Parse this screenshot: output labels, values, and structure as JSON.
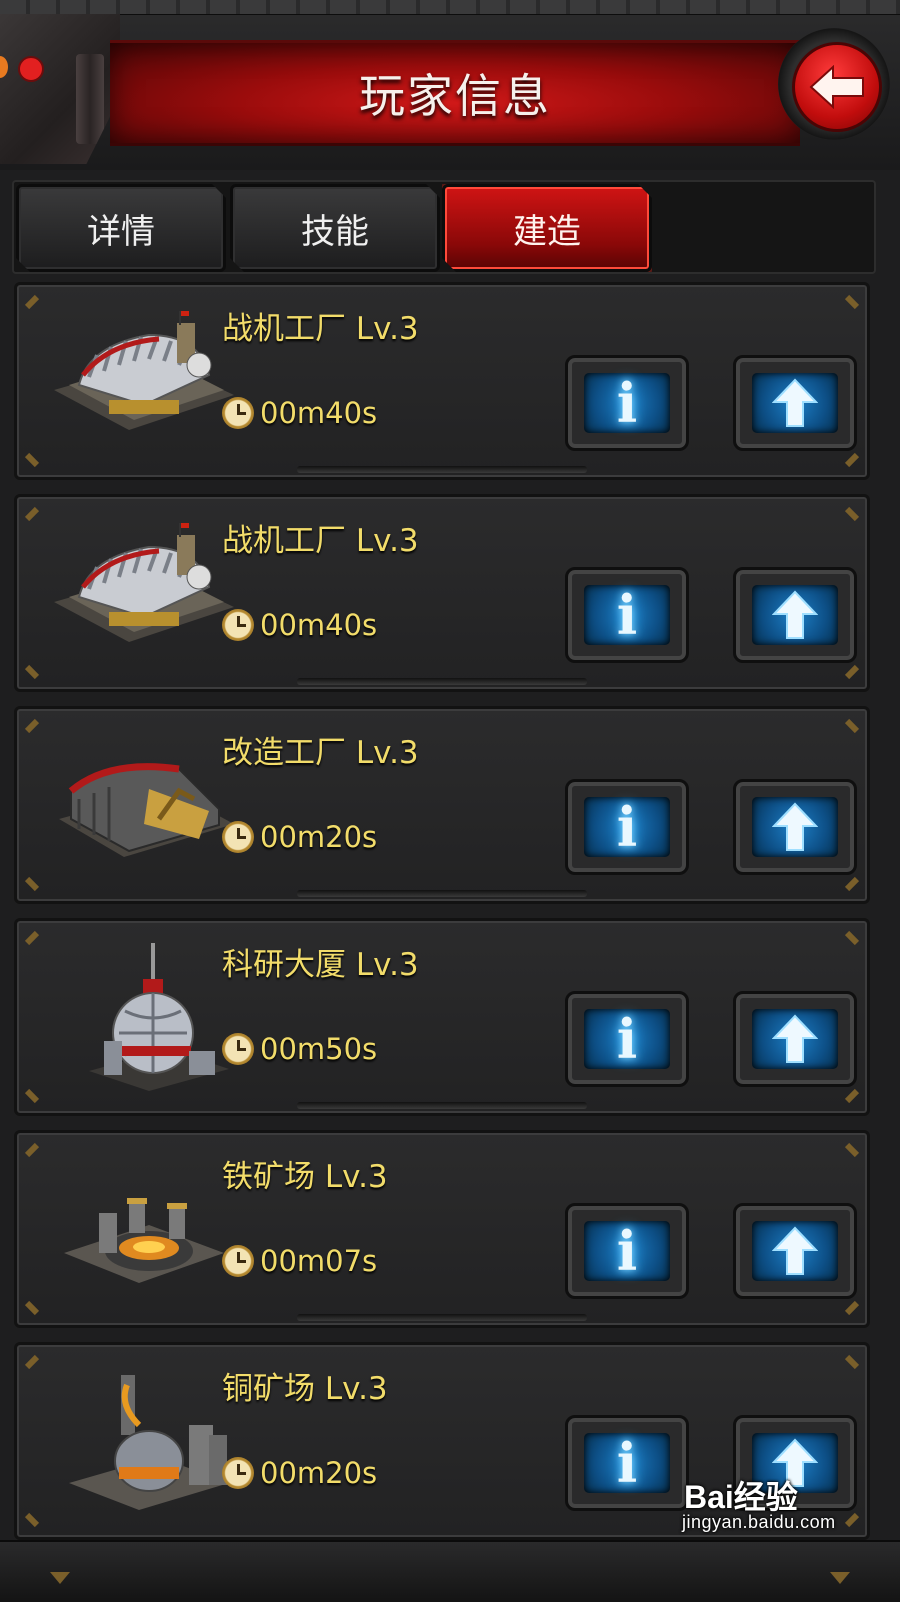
{
  "header": {
    "title": "玩家信息"
  },
  "tabs": [
    {
      "label": "详情",
      "active": false
    },
    {
      "label": "技能",
      "active": false
    },
    {
      "label": "建造",
      "active": true
    }
  ],
  "buildings": [
    {
      "name": "战机工厂 Lv.3",
      "time": "00m40s",
      "icon": "aircraft-factory-icon"
    },
    {
      "name": "战机工厂 Lv.3",
      "time": "00m40s",
      "icon": "aircraft-factory-icon"
    },
    {
      "name": "改造工厂 Lv.3",
      "time": "00m20s",
      "icon": "modification-factory-icon"
    },
    {
      "name": "科研大厦 Lv.3",
      "time": "00m50s",
      "icon": "research-tower-icon"
    },
    {
      "name": "铁矿场 Lv.3",
      "time": "00m07s",
      "icon": "iron-mine-icon"
    },
    {
      "name": "铜矿场 Lv.3",
      "time": "00m20s",
      "icon": "copper-mine-icon"
    }
  ],
  "buttons": {
    "info_glyph": "i"
  },
  "colors": {
    "accent_red": "#c20d0d",
    "gold_text": "#f2dc6a",
    "button_blue": "#1d7fc7"
  },
  "watermark": {
    "logo": "Bai经验",
    "url": "jingyan.baidu.com"
  }
}
